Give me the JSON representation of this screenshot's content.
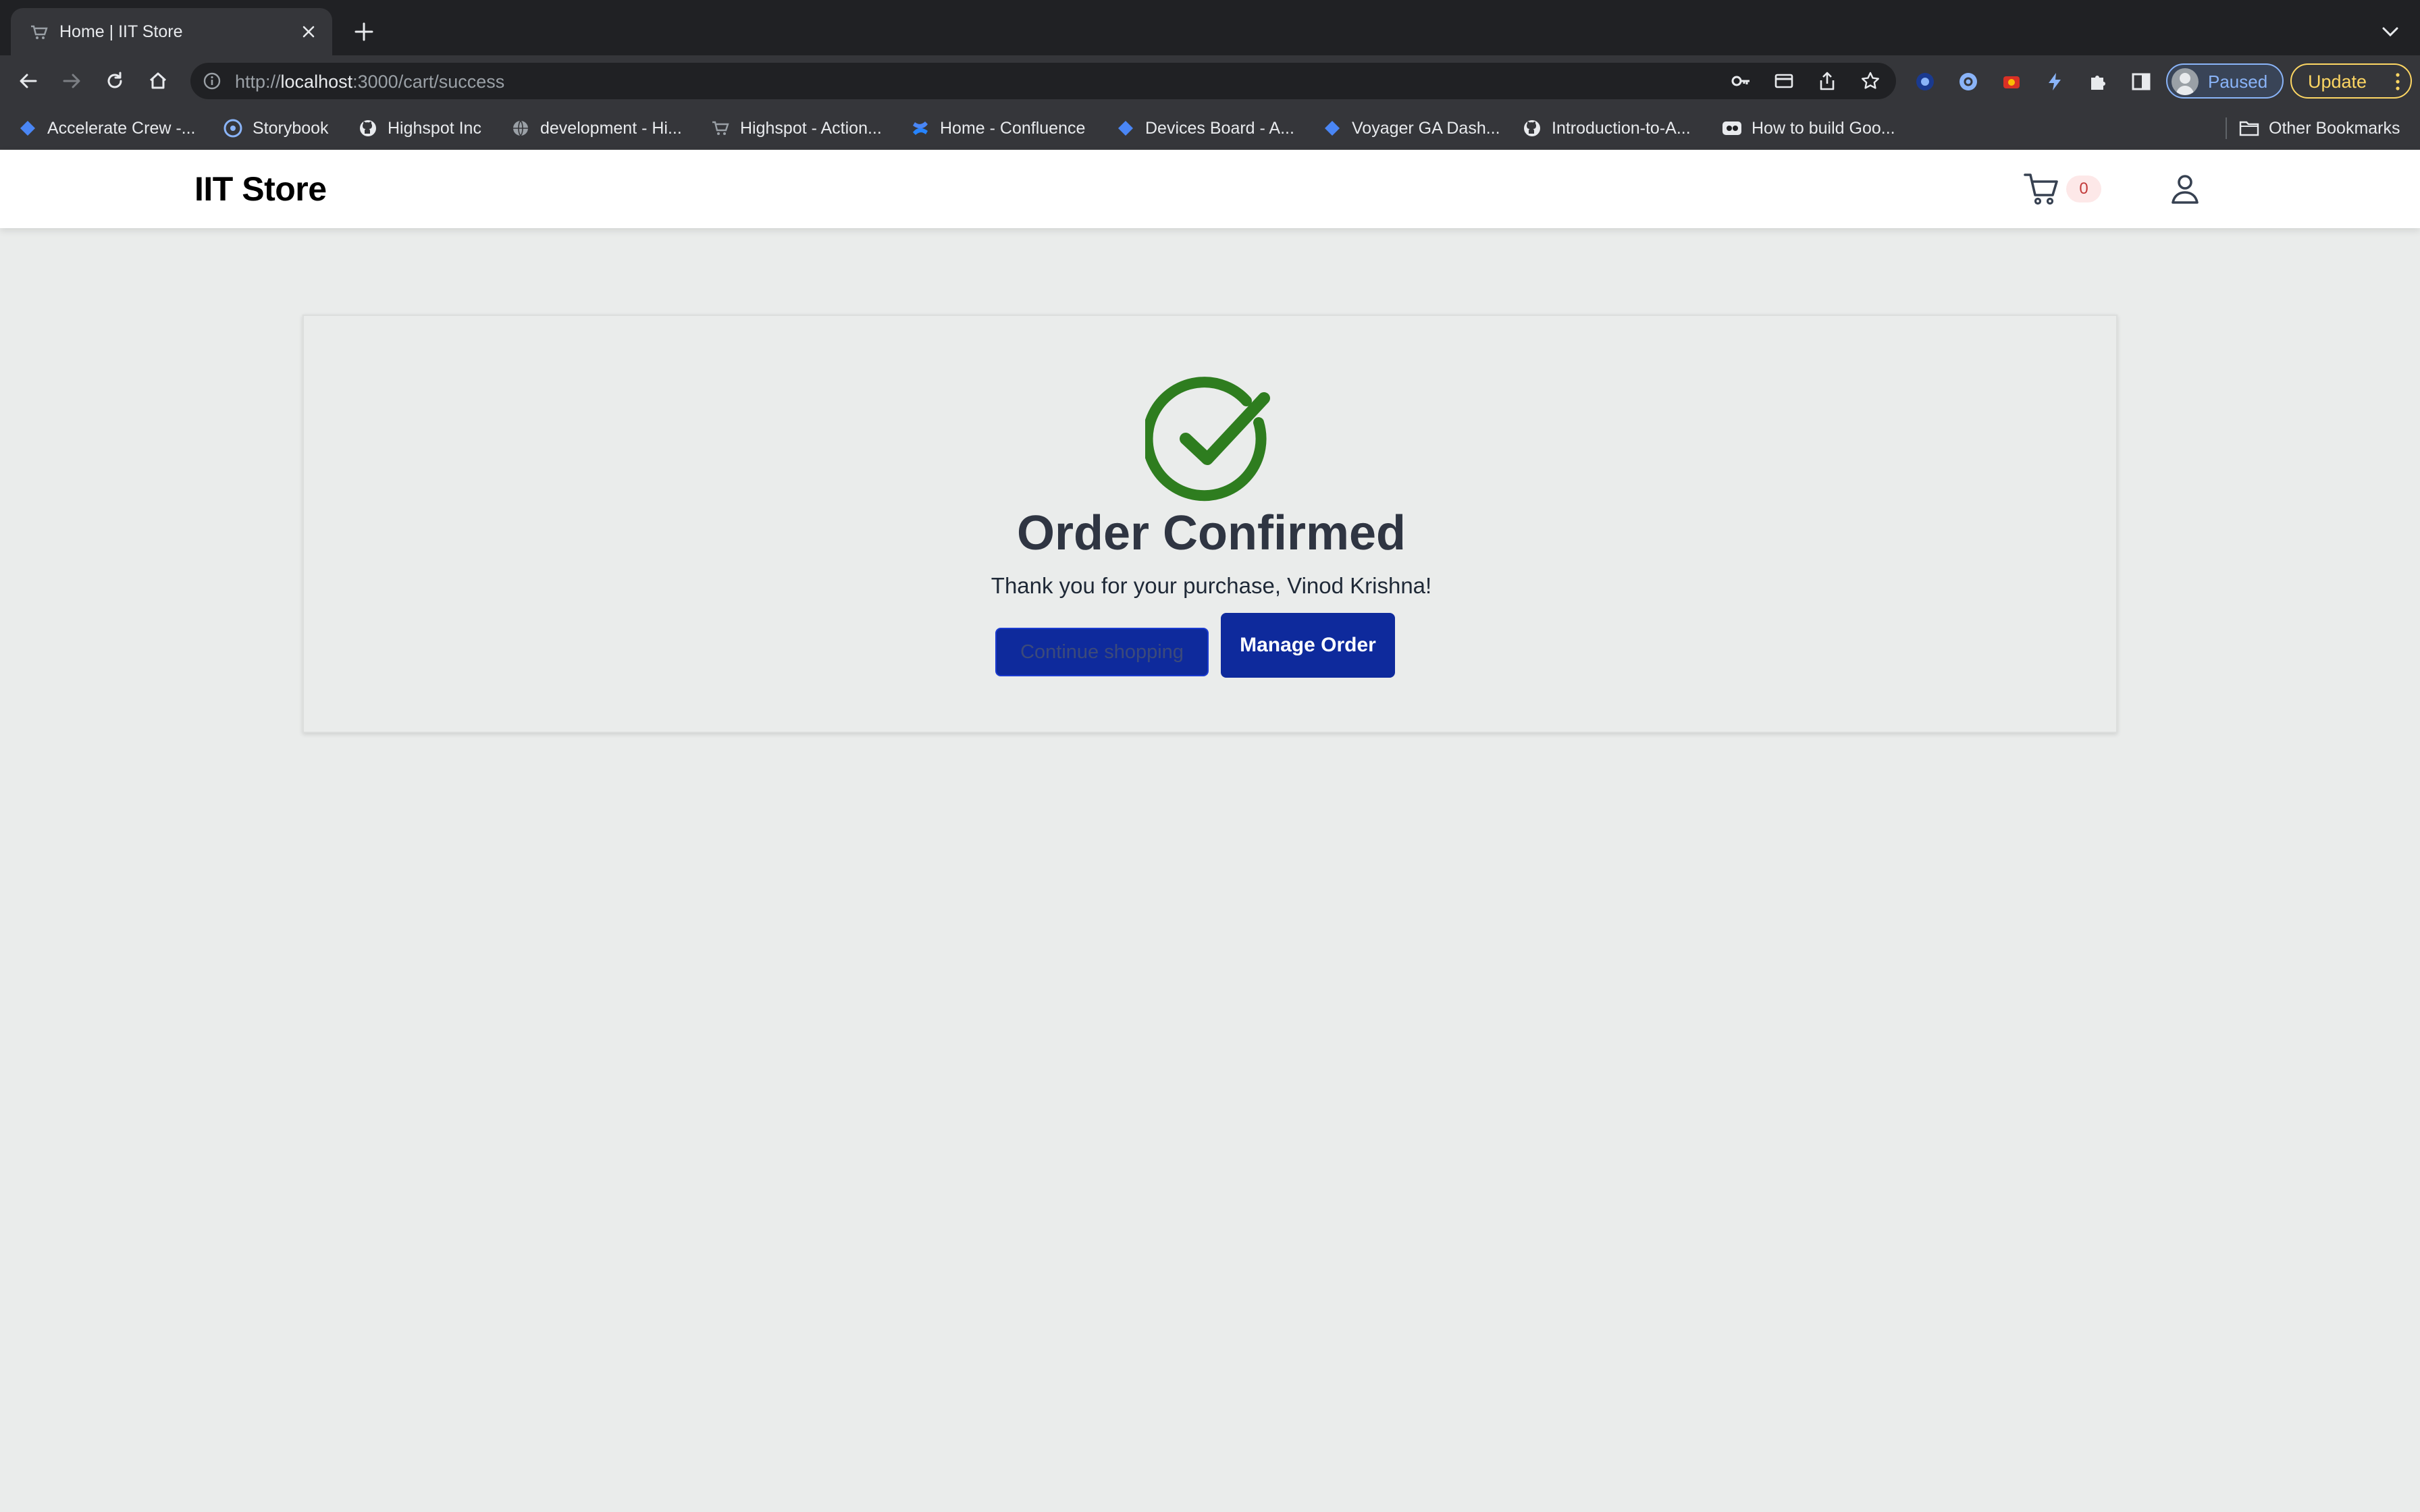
{
  "browser": {
    "tab": {
      "title": "Home | IIT Store"
    },
    "address": {
      "scheme": "http://",
      "host": "localhost",
      "path": ":3000/cart/success"
    },
    "profile": {
      "status": "Paused"
    },
    "update_label": "Update",
    "bookmarks": [
      {
        "label": "Accelerate Crew -...",
        "icon": "diamond-icon"
      },
      {
        "label": "Storybook",
        "icon": "storybook-icon"
      },
      {
        "label": "Highspot Inc",
        "icon": "github-icon"
      },
      {
        "label": "development - Hi...",
        "icon": "globe-icon"
      },
      {
        "label": "Highspot - Action...",
        "icon": "cart-icon"
      },
      {
        "label": "Home - Confluence",
        "icon": "confluence-icon"
      },
      {
        "label": "Devices Board - A...",
        "icon": "diamond-icon"
      },
      {
        "label": "Voyager GA Dash...",
        "icon": "diamond-icon"
      },
      {
        "label": "Introduction-to-A...",
        "icon": "github-icon"
      },
      {
        "label": "How to build Goo...",
        "icon": "video-icon"
      }
    ],
    "other_bookmarks": "Other Bookmarks"
  },
  "header": {
    "logo": "IIT Store",
    "cart_count": "0"
  },
  "confirmation": {
    "title": "Order Confirmed",
    "message": "Thank you for your purchase, Vinod Krishna!",
    "continue_label": "Continue shopping",
    "manage_label": "Manage Order"
  },
  "colors": {
    "success": "#2e7d1f",
    "primary_button": "#0e2a9c",
    "page_background": "#eaeceb"
  }
}
